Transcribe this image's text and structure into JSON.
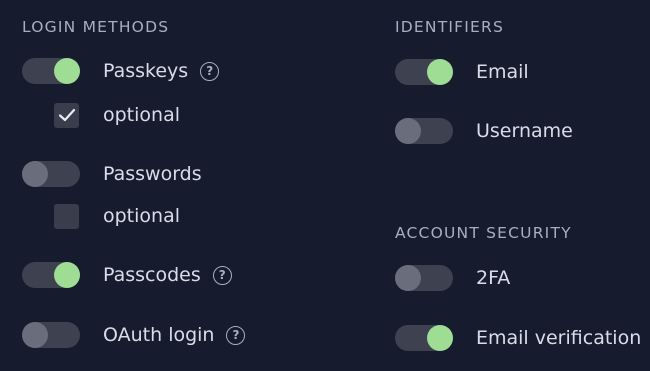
{
  "login_methods": {
    "title": "LOGIN METHODS",
    "items": [
      {
        "label": "Passkeys",
        "enabled": true,
        "has_help": true,
        "optional_label": "optional",
        "optional_checked": true
      },
      {
        "label": "Passwords",
        "enabled": false,
        "has_help": false,
        "optional_label": "optional",
        "optional_checked": false
      },
      {
        "label": "Passcodes",
        "enabled": true,
        "has_help": true
      },
      {
        "label": "OAuth login",
        "enabled": false,
        "has_help": true
      }
    ]
  },
  "identifiers": {
    "title": "IDENTIFIERS",
    "items": [
      {
        "label": "Email",
        "enabled": true
      },
      {
        "label": "Username",
        "enabled": false
      }
    ]
  },
  "account_security": {
    "title": "ACCOUNT SECURITY",
    "items": [
      {
        "label": "2FA",
        "enabled": false
      },
      {
        "label": "Email verification",
        "enabled": true
      }
    ]
  },
  "icons": {
    "help": "question-circle-icon",
    "check": "checkmark-icon"
  },
  "colors": {
    "background": "#161b2e",
    "toggle_on": "#9fdc94",
    "toggle_track": "#3d4150",
    "toggle_off_knob": "#6a6e7c"
  }
}
